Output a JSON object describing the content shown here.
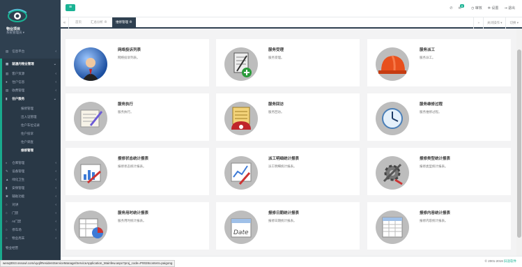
{
  "brand": {
    "name": "物业项目",
    "subtitle": "系统管理员 ▾"
  },
  "topbar": {
    "menu_icon": "menu-icon",
    "phone_icon": "phone-icon",
    "message_icon": "message-icon",
    "message_count": "8",
    "audit_label": "审核",
    "settings_label": "设置",
    "logout_label": "退出"
  },
  "nav": {
    "info_platform": "信息平台",
    "app_mgmt": "就通内物业管理",
    "items": [
      {
        "label": "客户资源"
      },
      {
        "label": "住户信息"
      },
      {
        "label": "收费管理"
      },
      {
        "label": "住户服务"
      }
    ],
    "sub_items": [
      {
        "label": "报修管理"
      },
      {
        "label": "出入证管理"
      },
      {
        "label": "住户车位记录"
      },
      {
        "label": "住户投诉"
      },
      {
        "label": "住户调查"
      },
      {
        "label": "维修管理"
      }
    ],
    "lower_items": [
      {
        "label": "仓库管理"
      },
      {
        "label": "设备管理"
      },
      {
        "label": "绿化卫生"
      },
      {
        "label": "安保管理"
      },
      {
        "label": "辅助功能"
      },
      {
        "label": "对讲"
      },
      {
        "label": "门禁"
      },
      {
        "label": "AI门禁"
      },
      {
        "label": "停车场"
      },
      {
        "label": "物业周末"
      },
      {
        "label": "物业经营"
      }
    ]
  },
  "tabs": {
    "home": "首页",
    "tab1": "汇总分析 ⊗",
    "tab2": "维修管理 ⊗",
    "close_ops": "关闭操作 ▾",
    "switch": "切换 ▾"
  },
  "cards": [
    {
      "title": "网络投诉列表",
      "desc": "网络投诉列表。",
      "icon": "globe-person-icon"
    },
    {
      "title": "服务受理",
      "desc": "服务受理。",
      "icon": "clipboard-plus-icon"
    },
    {
      "title": "服务派工",
      "desc": "服务派工。",
      "icon": "hardhat-icon"
    },
    {
      "title": "服务执行",
      "desc": "服务执行。",
      "icon": "document-pen-icon"
    },
    {
      "title": "服务回访",
      "desc": "服务回访。",
      "icon": "phone-call-icon"
    },
    {
      "title": "服务维修过程",
      "desc": "服务维修过程。",
      "icon": "clock-icon"
    },
    {
      "title": "报修状态统计报表",
      "desc": "报修状态统计报表。",
      "icon": "chart-report-icon"
    },
    {
      "title": "派工明细统计报表",
      "desc": "派工明细统计报表。",
      "icon": "line-chart-icon"
    },
    {
      "title": "报修类型统计报表",
      "desc": "报修类型统计报表。",
      "icon": "tools-gear-icon"
    },
    {
      "title": "服务用时统计报表",
      "desc": "服务用时统计报表。",
      "icon": "pie-table-icon"
    },
    {
      "title": "报修日期统计报表",
      "desc": "报修日期统计报表。",
      "icon": "calendar-date-icon"
    },
    {
      "title": "报修内容统计报表",
      "desc": "报修内容统计报表。",
      "icon": "spreadsheet-icon"
    }
  ],
  "footer": {
    "copyright": "© 2001-2019 ",
    "company": "旧途软件"
  },
  "statusbar": {
    "url": "wesqt0S3.sssowl.com/uyql/ResidentServiceManage/ServiceApplication_Mainfew.aspx?proj_code=P0028content=paigong"
  },
  "colors": {
    "accent": "#1ab394",
    "sidebar": "#2f4050"
  }
}
